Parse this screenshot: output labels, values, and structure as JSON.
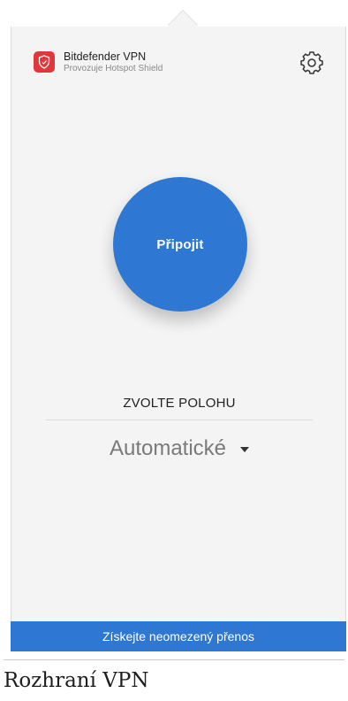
{
  "app": {
    "name": "Bitdefender VPN",
    "subtitle": "Provozuje Hotspot Shield",
    "logo_icon": "shield-icon",
    "settings_icon": "gear-icon"
  },
  "main": {
    "connect_label": "Připojit"
  },
  "location": {
    "title": "ZVOLTE POLOHU",
    "selected": "Automatické",
    "dropdown_icon": "caret-down-icon"
  },
  "promo": {
    "label": "Získejte neomezený přenos"
  },
  "caption": "Rozhraní VPN",
  "colors": {
    "accent": "#2e77d2",
    "brand": "#e0373c",
    "panel_bg": "#f4f4f4"
  }
}
